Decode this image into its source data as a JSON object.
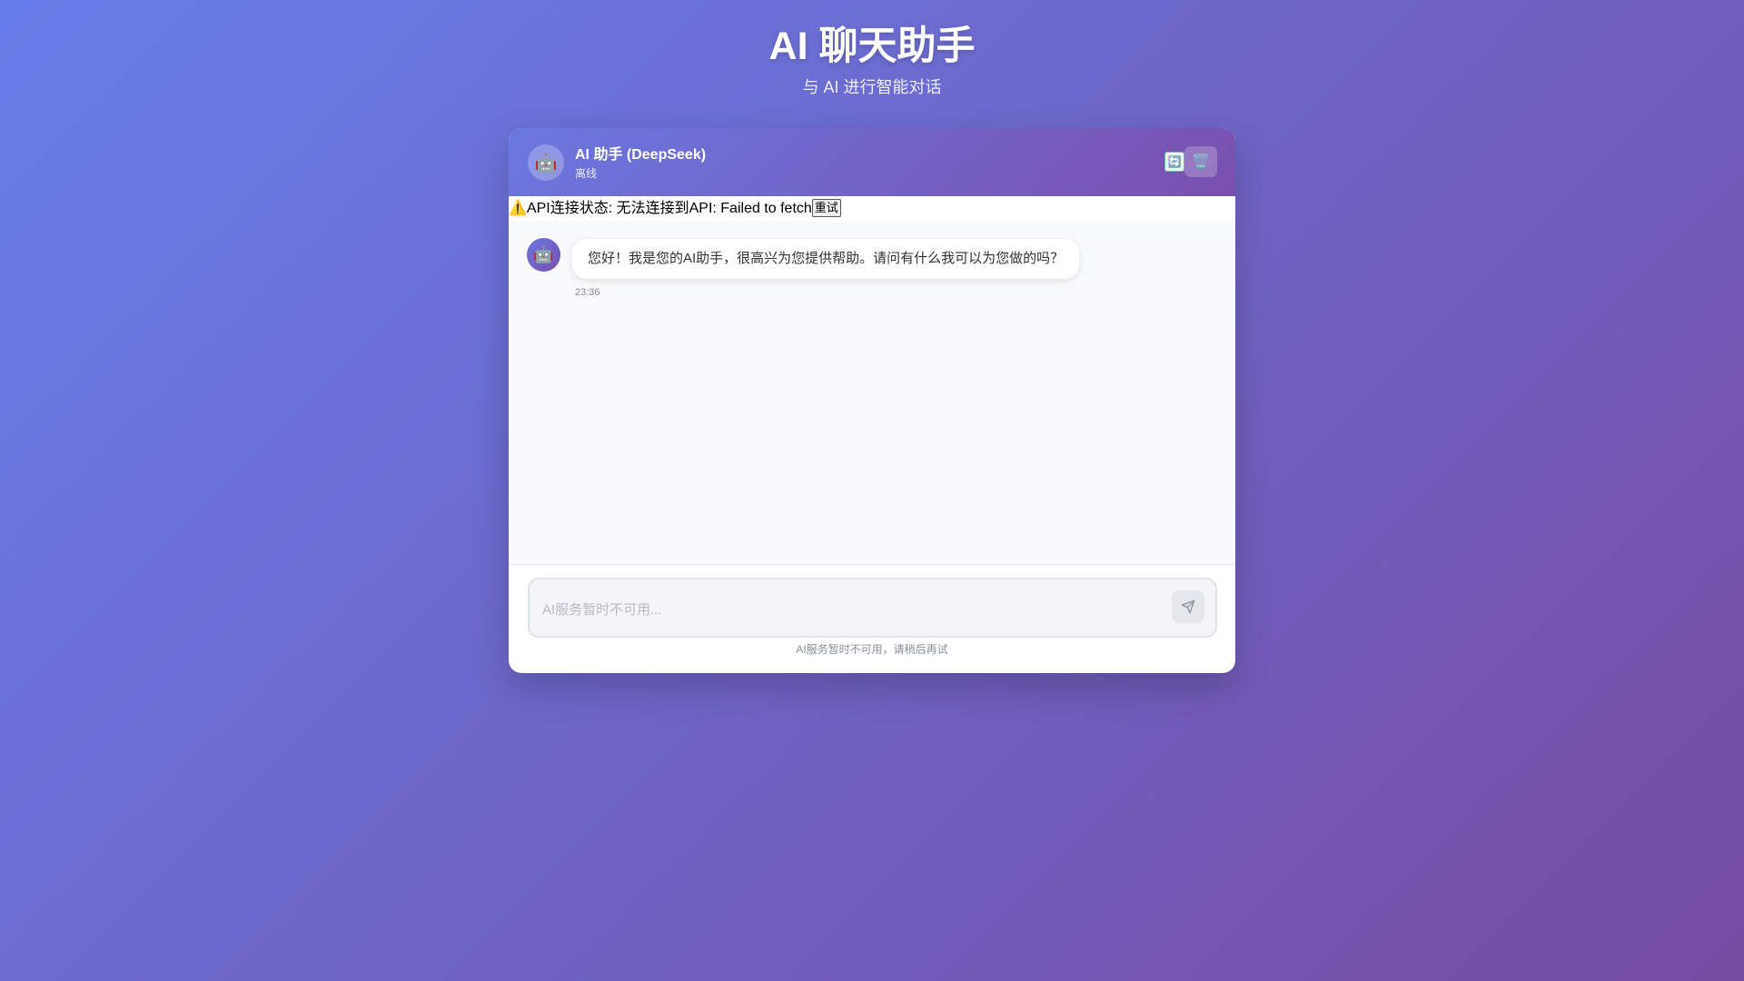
{
  "page": {
    "title": "AI 聊天助手",
    "subtitle": "与 AI 进行智能对话"
  },
  "header": {
    "avatar_icon": "robot-icon",
    "avatar_glyph": "🤖",
    "name": "AI 助手 (DeepSeek)",
    "status": "离线",
    "refresh_glyph": "🔄",
    "clear_glyph": "🗑️"
  },
  "api_status": {
    "warning_glyph": "⚠️",
    "text": "API连接状态: 无法连接到API: Failed to fetch",
    "retry_label": "重试"
  },
  "messages": [
    {
      "sender": "assistant",
      "avatar_glyph": "🤖",
      "text": "您好！我是您的AI助手，很高兴为您提供帮助。请问有什么我可以为您做的吗？",
      "time": "23:36"
    }
  ],
  "composer": {
    "placeholder": "AI服务暂时不可用...",
    "value": "",
    "hint": "AI服务暂时不可用，请稍后再试"
  },
  "colors": {
    "gradient_start": "#667eea",
    "gradient_end": "#764ba2"
  }
}
